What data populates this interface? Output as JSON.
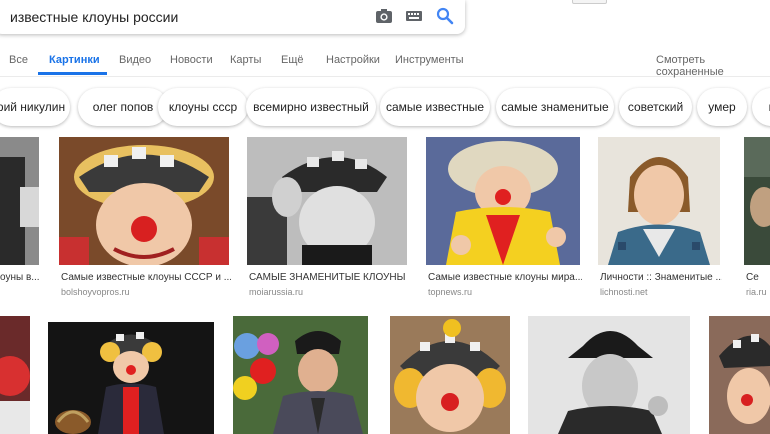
{
  "search": {
    "query": "известные клоуны россии"
  },
  "icons": {
    "camera": "camera-icon",
    "keyboard": "keyboard-icon",
    "search": "search-icon"
  },
  "tabs": [
    {
      "label": "Все"
    },
    {
      "label": "Картинки",
      "active": true
    },
    {
      "label": "Видео"
    },
    {
      "label": "Новости"
    },
    {
      "label": "Карты"
    },
    {
      "label": "Ещё"
    },
    {
      "label": "Настройки"
    },
    {
      "label": "Инструменты"
    }
  ],
  "saved_link": "Смотреть сохраненные",
  "chips": [
    "рий никулин",
    "олег попов",
    "клоуны ссср",
    "всемирно известный",
    "самые известные",
    "самые знаменитые",
    "советский",
    "умер",
    "ц"
  ],
  "results_row1": [
    {
      "title": "оуны в...",
      "source": ""
    },
    {
      "title": "Самые известные клоуны СССР и ...",
      "source": "bolshoyvopros.ru"
    },
    {
      "title": "САМЫЕ ЗНАМЕНИТЫЕ КЛОУНЫ ...",
      "source": "moiarussia.ru"
    },
    {
      "title": "Самые известные клоуны мира...",
      "source": "topnews.ru"
    },
    {
      "title": "Личности :: Знаменитые ...",
      "source": "lichnosti.net"
    },
    {
      "title": "Се",
      "source": "ria.ru"
    }
  ],
  "colors": {
    "accent": "#1a73e8",
    "text": "#222222",
    "muted": "#666666"
  }
}
